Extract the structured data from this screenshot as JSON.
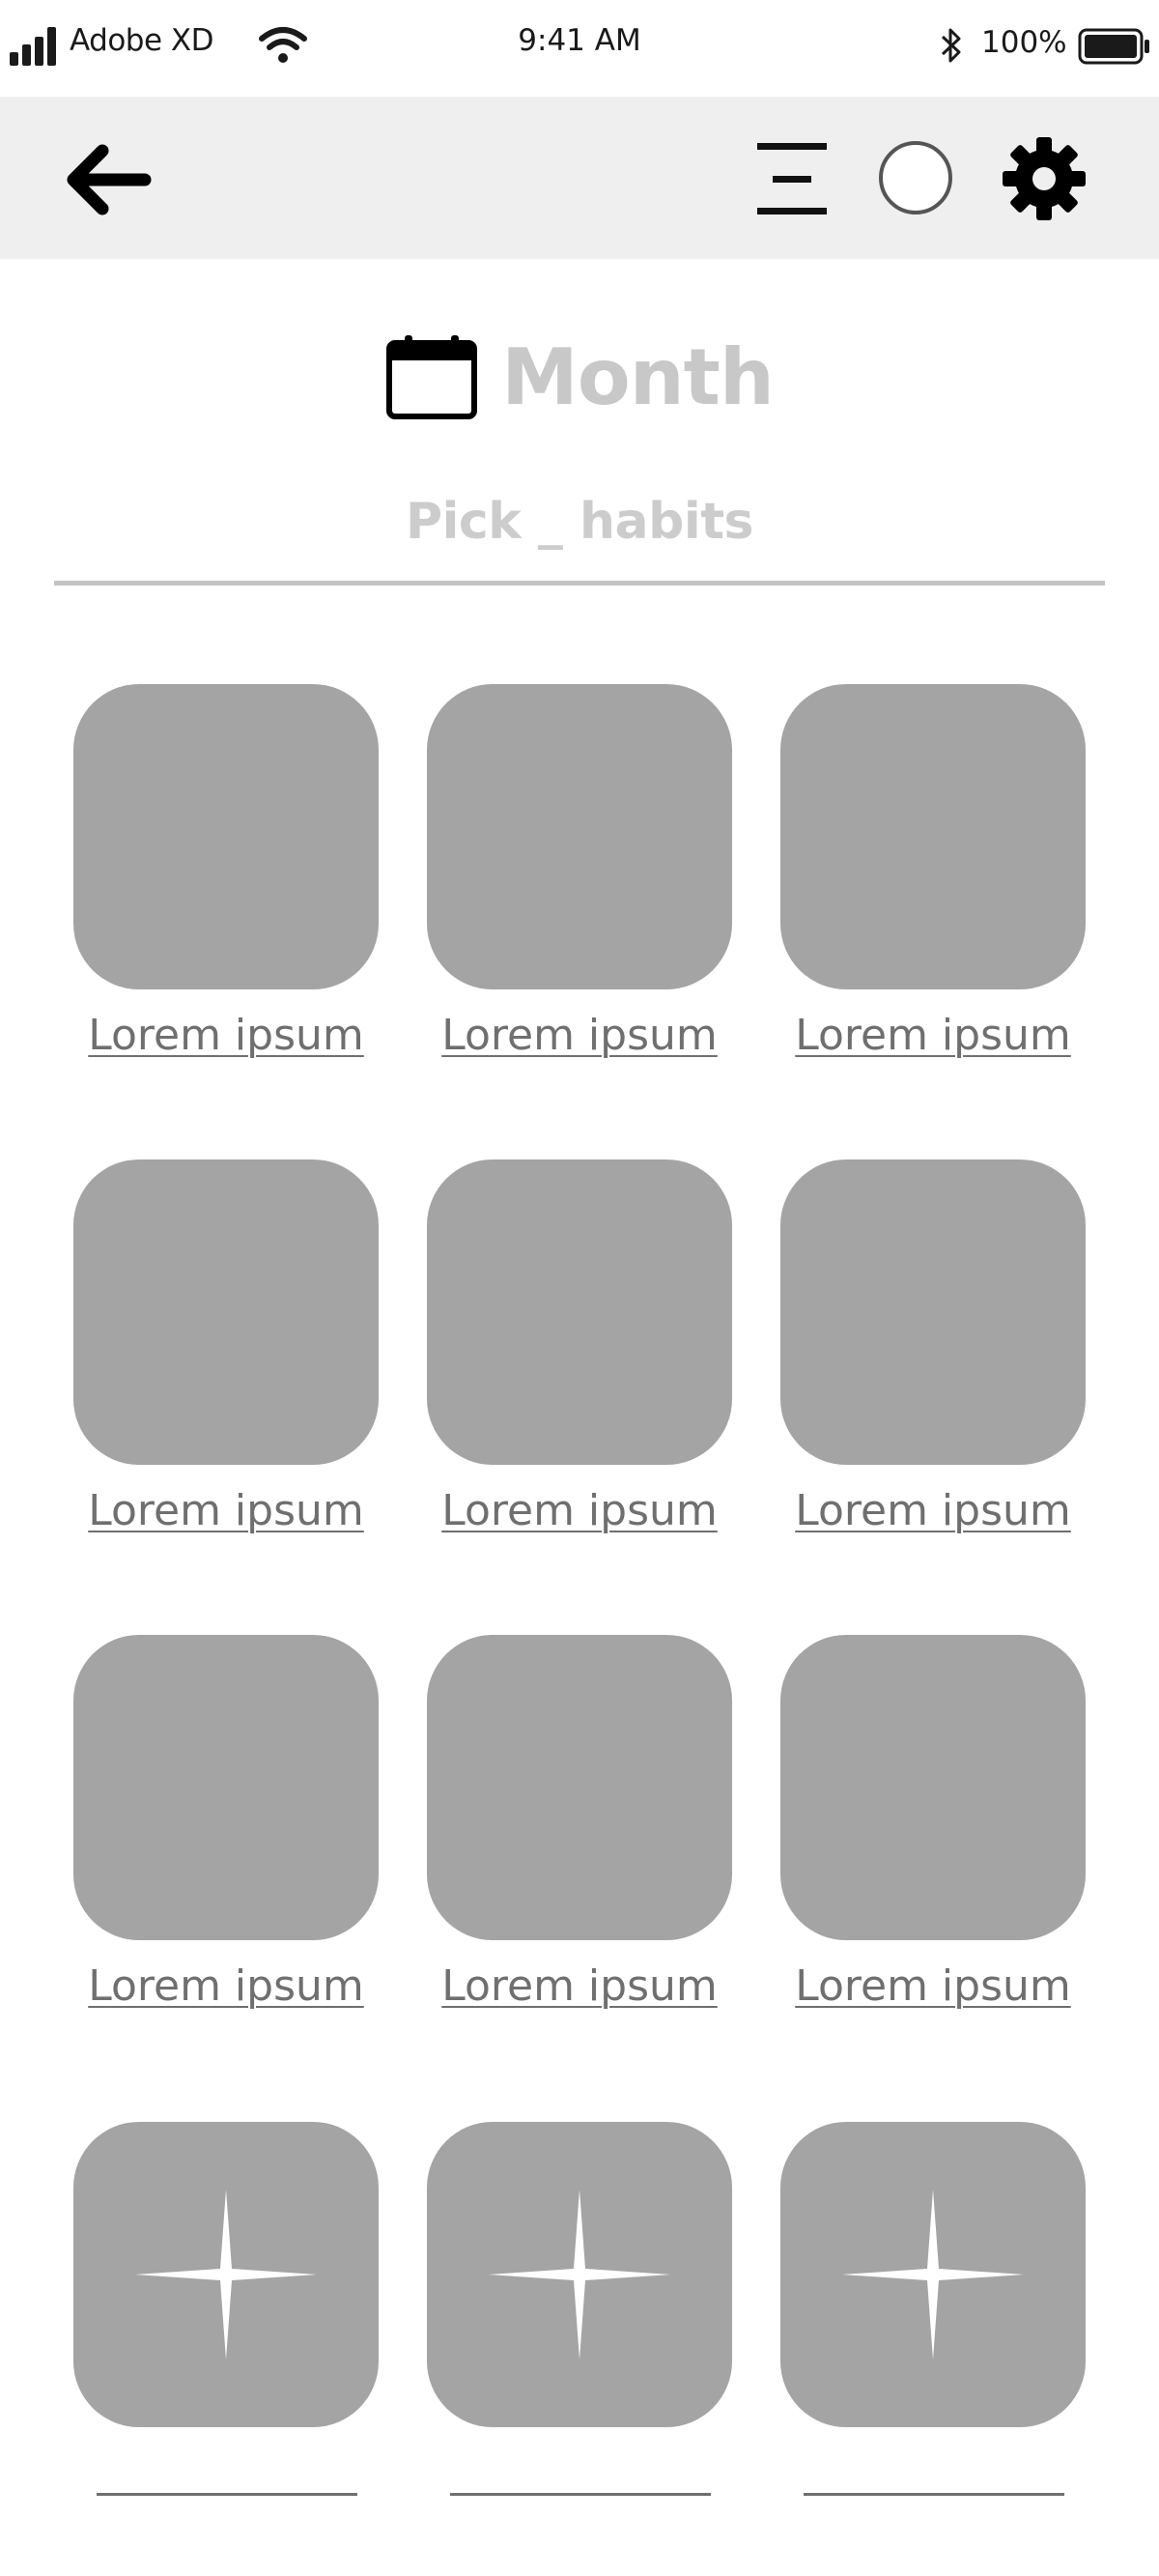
{
  "status_bar": {
    "carrier": "Adobe XD",
    "time": "9:41 AM",
    "battery_percent": "100%"
  },
  "nav": {
    "back_icon": "arrow-left-icon",
    "menu_icon": "menu-icon",
    "circle_icon": "circle-icon",
    "settings_icon": "gear-icon"
  },
  "header": {
    "icon": "calendar-icon",
    "title": "Month",
    "subtitle": "Pick _ habits"
  },
  "habits": [
    {
      "label": "Lorem ipsum"
    },
    {
      "label": "Lorem ipsum"
    },
    {
      "label": "Lorem ipsum"
    },
    {
      "label": "Lorem ipsum"
    },
    {
      "label": "Lorem ipsum"
    },
    {
      "label": "Lorem ipsum"
    },
    {
      "label": "Lorem ipsum"
    },
    {
      "label": "Lorem ipsum"
    },
    {
      "label": "Lorem ipsum"
    }
  ],
  "empty_slots": [
    {
      "icon": "sparkle-icon"
    },
    {
      "icon": "sparkle-icon"
    },
    {
      "icon": "sparkle-icon"
    }
  ],
  "colors": {
    "nav_background": "#efefef",
    "tile": "#a4a4a4",
    "title": "#c8c8c8",
    "label": "#6f6f6f"
  }
}
